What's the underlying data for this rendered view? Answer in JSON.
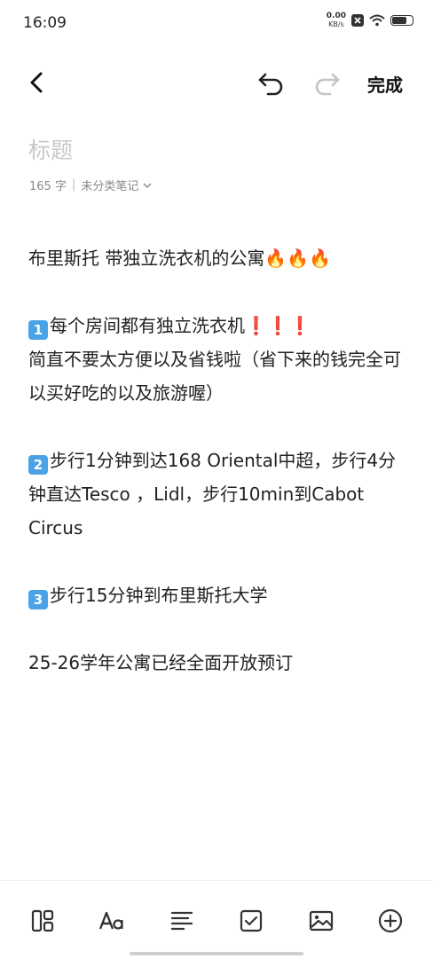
{
  "status_bar": {
    "time": "16:09",
    "net_speed_value": "0.00",
    "net_speed_unit": "KB/s",
    "battery_level": 0.8,
    "icons": [
      "sim-off-icon",
      "wifi-icon",
      "battery-icon"
    ]
  },
  "toolbar": {
    "back_icon": "chevron-left-icon",
    "undo_icon": "undo-icon",
    "redo_icon": "redo-icon",
    "redo_enabled": false,
    "done_label": "完成"
  },
  "note": {
    "title_placeholder": "标题",
    "char_count": "165 字",
    "folder": "未分类笔记",
    "lines": {
      "l1": "布里斯托 带独立洗衣机的公寓🔥🔥🔥",
      "n1": "1",
      "l2": "每个房间都有独立洗衣机❗❗❗",
      "l3": "简直不要太方便以及省钱啦（省下来的钱完全可以买好吃的以及旅游喔）",
      "n2": "2",
      "l4": "步行1分钟到达168 Oriental中超，步行4分钟直达Tesco ，Lidl，步行10min到Cabot Circus",
      "n3": "3",
      "l5": "步行15分钟到布里斯托大学",
      "l6": "25-26学年公寓已经全面开放预订"
    }
  },
  "bottom_toolbar": {
    "icons": [
      "layout-icon",
      "text-format-icon",
      "paragraph-icon",
      "checklist-icon",
      "image-icon",
      "add-icon"
    ]
  },
  "colors": {
    "placeholder": "#c8c8c8",
    "text": "#222222",
    "keycap": "#4aa3e6",
    "disabled_icon": "#c4c4c4"
  }
}
